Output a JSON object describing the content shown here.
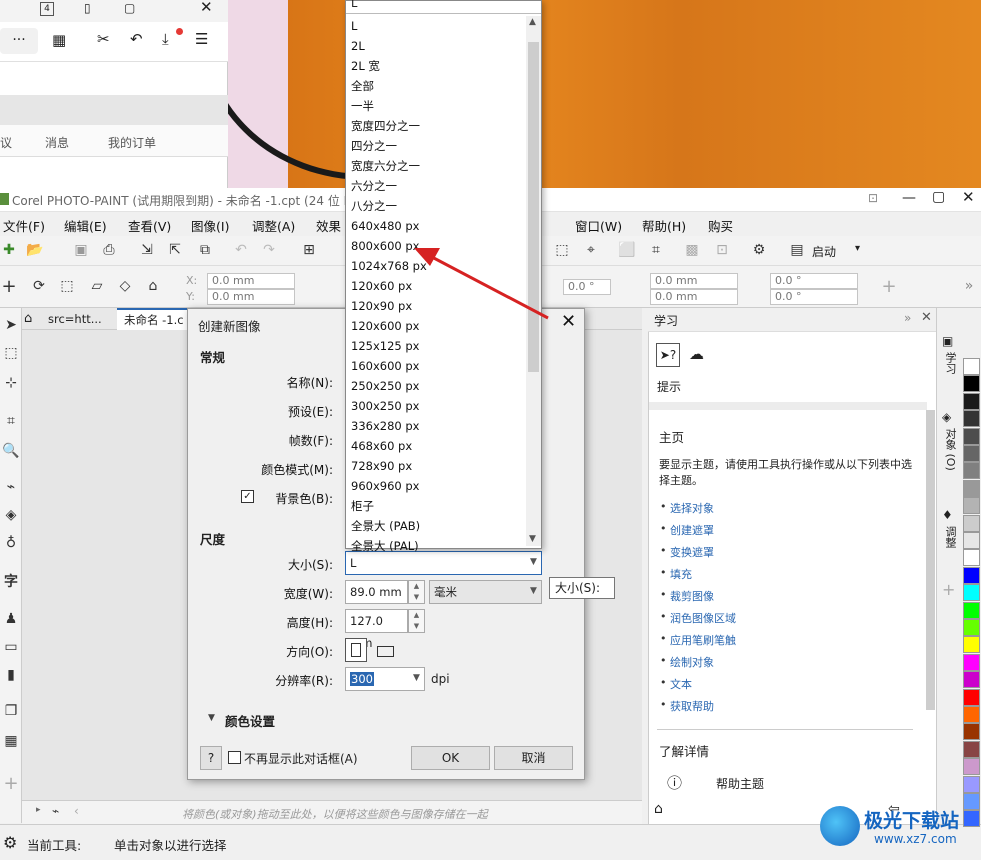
{
  "browser": {
    "tab_count": "4",
    "nav_items": [
      "议",
      "消息",
      "我的订单"
    ]
  },
  "app": {
    "title": "Corel PHOTO-PAINT (试用期限到期) - 未命名 -1.cpt (24 位 RG",
    "menu": [
      "文件(F)",
      "编辑(E)",
      "查看(V)",
      "图像(I)",
      "调整(A)",
      "效果",
      "窗口(W)",
      "帮助(H)",
      "购买"
    ],
    "launch_label": "启动",
    "coords": {
      "x_label": "X:",
      "y_label": "Y:",
      "x": "0.0 mm",
      "y": "0.0 mm",
      "angle1": "0.0 °",
      "r1": "0.0 mm",
      "r2": "0.0 mm",
      "a2": "0.0 °",
      "a3": "0.0 °"
    },
    "doc_tabs": [
      "src=htt...",
      "未命名 -1.c"
    ],
    "color_hint": "将颜色(或对象)拖动至此处，以便将这些颜色与图像存储在一起",
    "status": {
      "label": "当前工具:",
      "value": "单击对象以进行选择"
    }
  },
  "panel": {
    "title": "学习",
    "hint": "提示",
    "home_title": "主页",
    "home_desc": "要显示主题，请使用工具执行操作或从以下列表中选择主题。",
    "links": [
      "选择对象",
      "创建遮罩",
      "变换遮罩",
      "填充",
      "裁剪图像",
      "润色图像区域",
      "应用笔刷笔触",
      "绘制对象",
      "文本",
      "获取帮助"
    ],
    "more_title": "了解详情",
    "help_topics": "帮助主题",
    "side_tabs": [
      "学习",
      "对象 (O)",
      "调整"
    ]
  },
  "palette_colors": [
    "#ffffff",
    "#000000",
    "#1a1a1a",
    "#333333",
    "#4d4d4d",
    "#666666",
    "#808080",
    "#999999",
    "#b3b3b3",
    "#cccccc",
    "#e6e6e6",
    "#ffffff",
    "#0000ff",
    "#00ffff",
    "#00ff00",
    "#66ff00",
    "#ffff00",
    "#ff00ff",
    "#cc00cc",
    "#ff0000",
    "#ff6600",
    "#993300",
    "#884444",
    "#cc99cc",
    "#9999ff",
    "#6699ff",
    "#3366ff"
  ],
  "dialog": {
    "title": "创建新图像",
    "section_general": "常规",
    "name_label": "名称(N):",
    "preset_label": "预设(E):",
    "frames_label": "帧数(F):",
    "color_mode_label": "颜色模式(M):",
    "bg_label": "背景色(B):",
    "section_size": "尺度",
    "size_label": "大小(S):",
    "size_value": "L",
    "width_label": "宽度(W):",
    "width_value": "89.0 mm",
    "unit_value": "毫米",
    "height_label": "高度(H):",
    "height_value": "127.0 mm",
    "orient_label": "方向(O):",
    "res_label": "分辨率(R):",
    "res_value": "300",
    "res_unit": "dpi",
    "color_settings": "颜色设置",
    "help_btn": "?",
    "no_show": "不再显示此对话框(A)",
    "ok": "OK",
    "cancel": "取消",
    "tooltip": "大小(S):"
  },
  "dropdown": {
    "top_value": "L",
    "options": [
      "L",
      "2L",
      "2L 宽",
      "全部",
      "一半",
      "宽度四分之一",
      "四分之一",
      "宽度六分之一",
      "六分之一",
      "八分之一",
      "640x480 px",
      "800x600 px",
      "1024x768 px",
      "120x60 px",
      "120x90 px",
      "120x600 px",
      "125x125 px",
      "160x600 px",
      "250x250 px",
      "300x250 px",
      "336x280 px",
      "468x60 px",
      "728x90 px",
      "960x960 px",
      "柜子",
      "全景大 (PAB)",
      "全景大 (PAL)"
    ]
  },
  "watermark": {
    "title": "极光下载站",
    "url": "www.xz7.com"
  }
}
